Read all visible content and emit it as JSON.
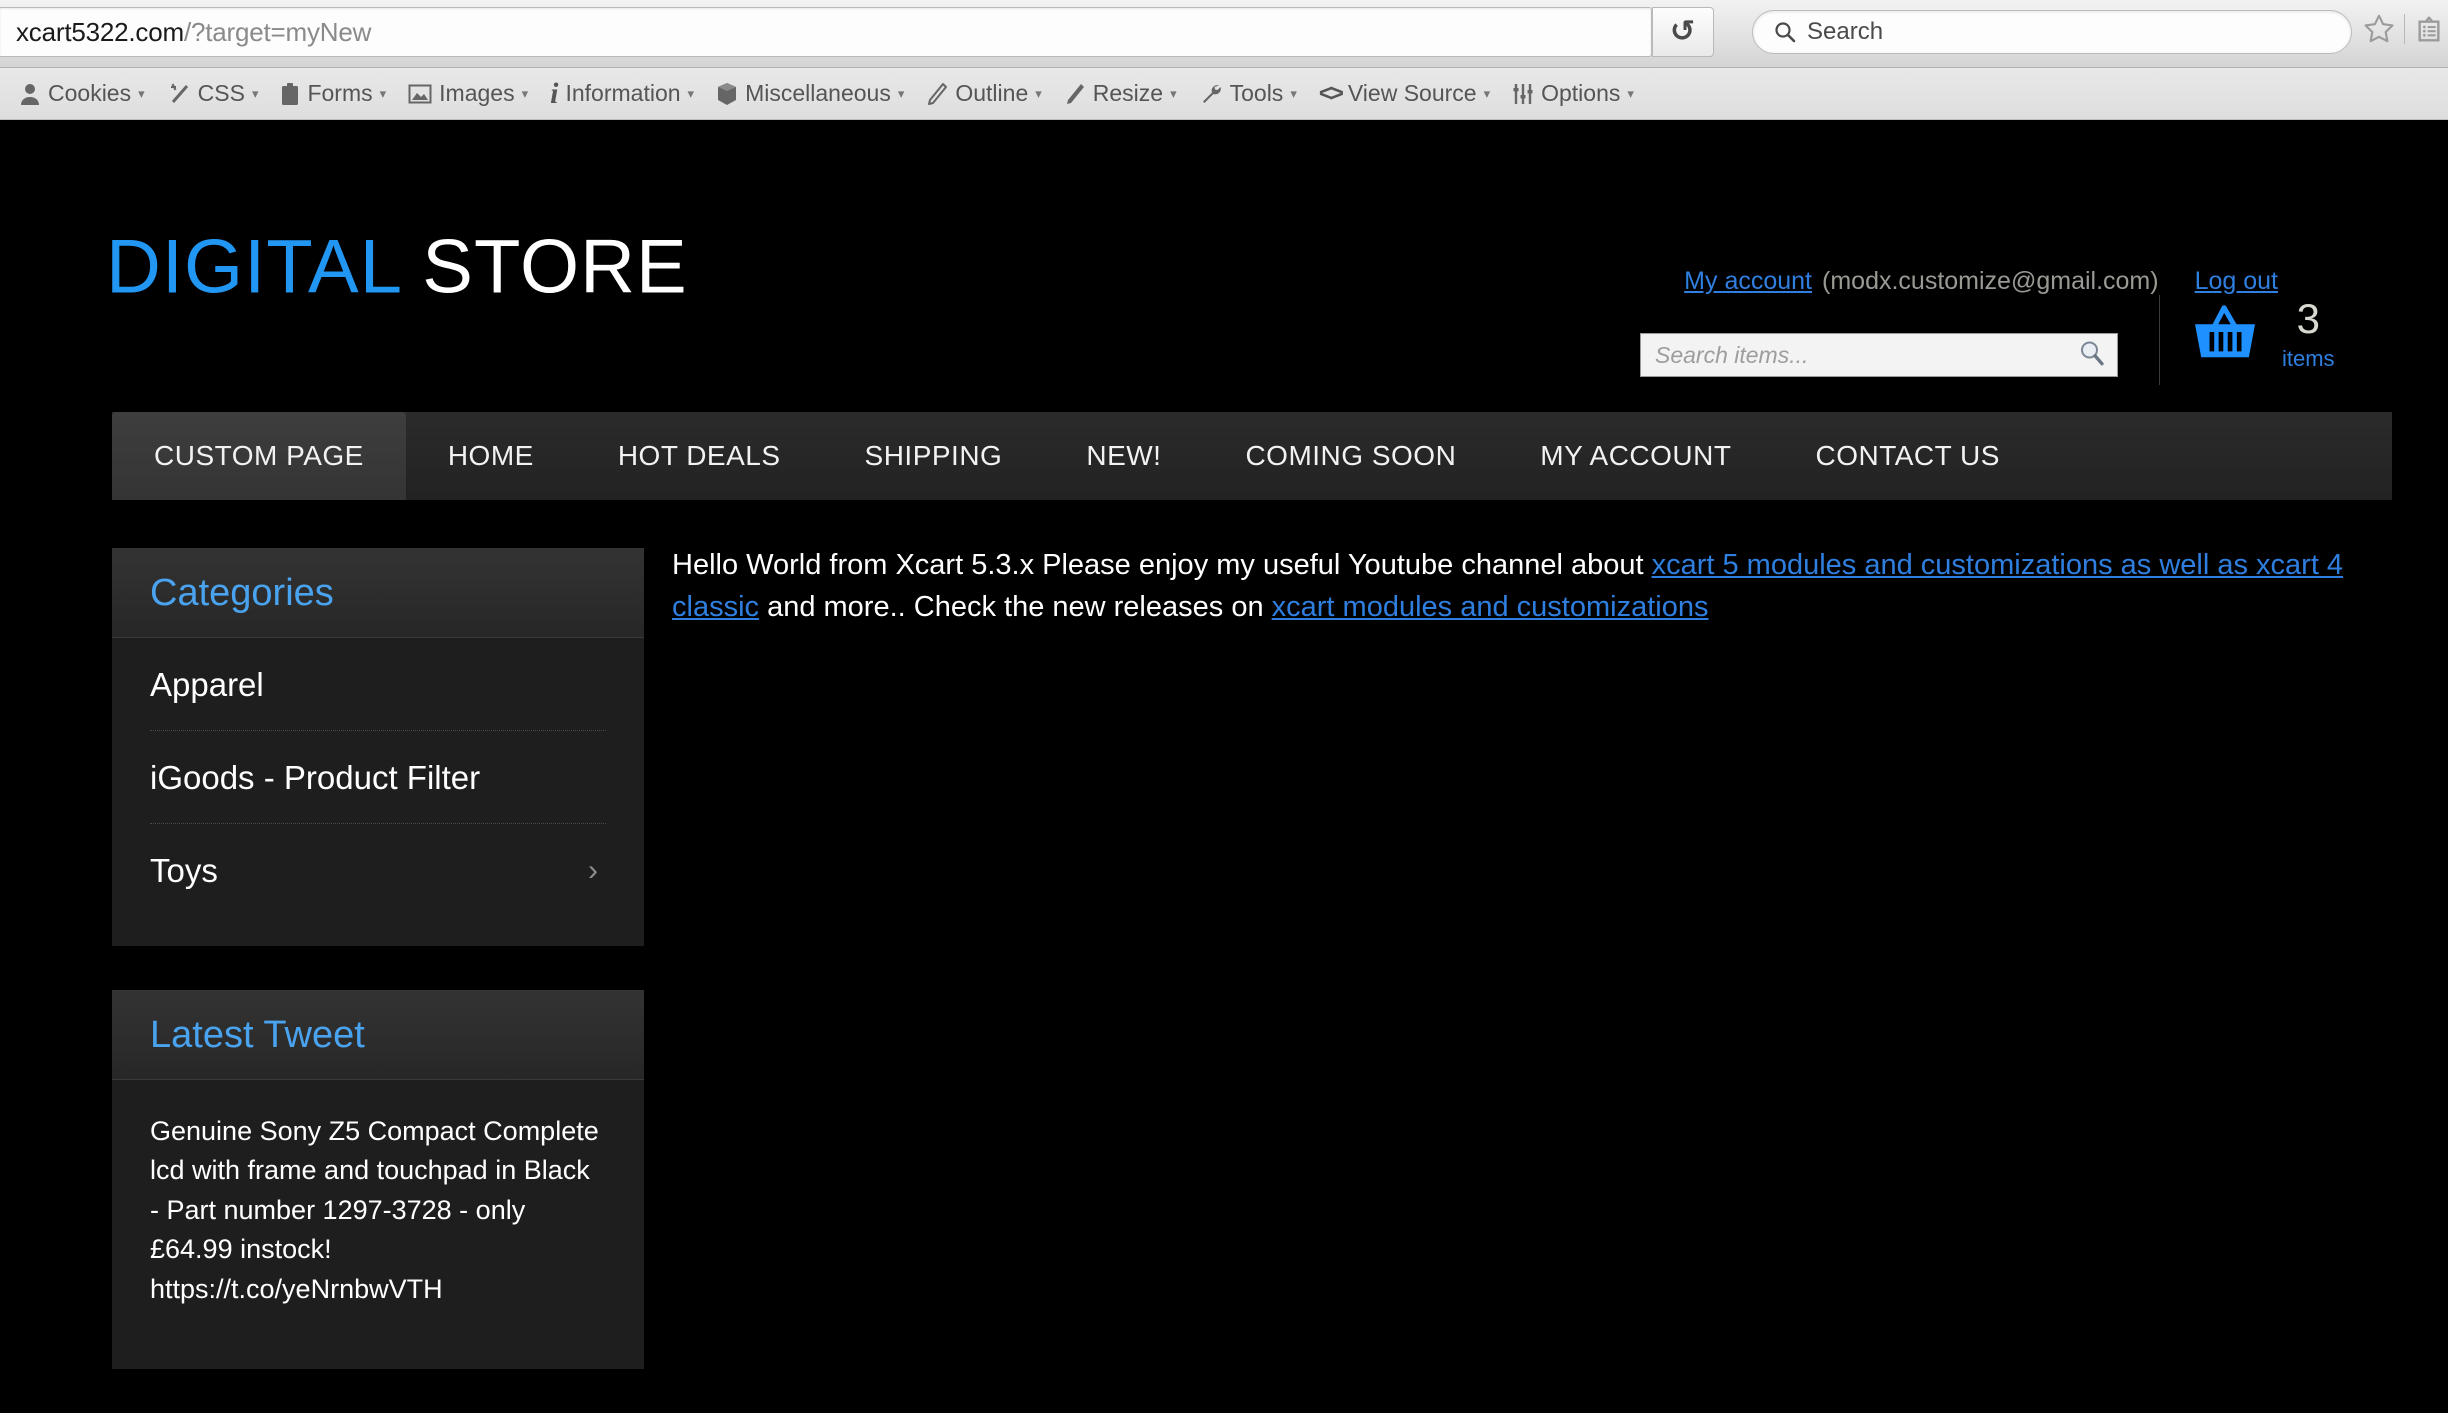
{
  "browser": {
    "url_host": "xcart5322.com",
    "url_path": "/?target=myNew",
    "reload_icon": "reload-icon",
    "search_placeholder": "Search",
    "search_icon": "search-icon",
    "bookmark_icon": "star-icon",
    "reader_icon": "reader-list-icon",
    "pocket_icon": "shield-icon"
  },
  "devtoolbar": {
    "items": [
      {
        "label": "Cookies",
        "icon": "person-icon"
      },
      {
        "label": "CSS",
        "icon": "magic-wand-icon"
      },
      {
        "label": "Forms",
        "icon": "clipboard-icon"
      },
      {
        "label": "Images",
        "icon": "picture-icon"
      },
      {
        "label": "Information",
        "icon": "info-italic-icon"
      },
      {
        "label": "Miscellaneous",
        "icon": "box-icon"
      },
      {
        "label": "Outline",
        "icon": "pencil-icon"
      },
      {
        "label": "Resize",
        "icon": "ruler-icon"
      },
      {
        "label": "Tools",
        "icon": "wrench-icon"
      },
      {
        "label": "View Source",
        "icon": "angle-brackets-icon"
      },
      {
        "label": "Options",
        "icon": "sliders-icon"
      }
    ],
    "caret": "▾"
  },
  "header": {
    "logo_first": "DIGITAL",
    "logo_second": " STORE",
    "logo_color_first": "#2196f3",
    "logo_color_second": "#ffffff",
    "my_account_label": "My account",
    "account_email": "(modx.customize@gmail.com)",
    "logout_label": "Log out",
    "search_placeholder": "Search items...",
    "search_icon": "magnifier-icon",
    "cart_icon": "shopping-basket-icon",
    "cart_icon_color": "#1e90ff",
    "cart_count": "3",
    "cart_items_label": "items"
  },
  "nav": {
    "items": [
      {
        "label": "CUSTOM PAGE",
        "active": true
      },
      {
        "label": "HOME",
        "active": false
      },
      {
        "label": "HOT DEALS",
        "active": false
      },
      {
        "label": "SHIPPING",
        "active": false
      },
      {
        "label": "NEW!",
        "active": false
      },
      {
        "label": "COMING SOON",
        "active": false
      },
      {
        "label": "MY ACCOUNT",
        "active": false
      },
      {
        "label": "CONTACT US",
        "active": false
      }
    ]
  },
  "sidebar": {
    "categories": {
      "title": "Categories",
      "items": [
        {
          "label": "Apparel",
          "has_chevron": false
        },
        {
          "label": "iGoods - Product Filter",
          "has_chevron": false
        },
        {
          "label": "Toys",
          "has_chevron": true,
          "chevron": "›"
        }
      ]
    },
    "tweet": {
      "title": "Latest Tweet",
      "text": "Genuine Sony Z5 Compact Complete lcd with frame and touchpad in Black - Part number 1297-3728 - only £64.99 instock! https://t.co/yeNrnbwVTH"
    }
  },
  "main": {
    "text_1": "Hello World from Xcart 5.3.x Please enjoy my useful Youtube channel about ",
    "link_1": "xcart 5 modules and customizations as well as xcart 4 classic",
    "text_2": " and more.. Check the new releases on ",
    "link_2": "xcart modules and customizations"
  },
  "colors": {
    "accent_blue": "#2196f3",
    "link_blue": "#2f7fe0",
    "panel_bg": "#1e1e1e",
    "page_bg": "#000000"
  }
}
